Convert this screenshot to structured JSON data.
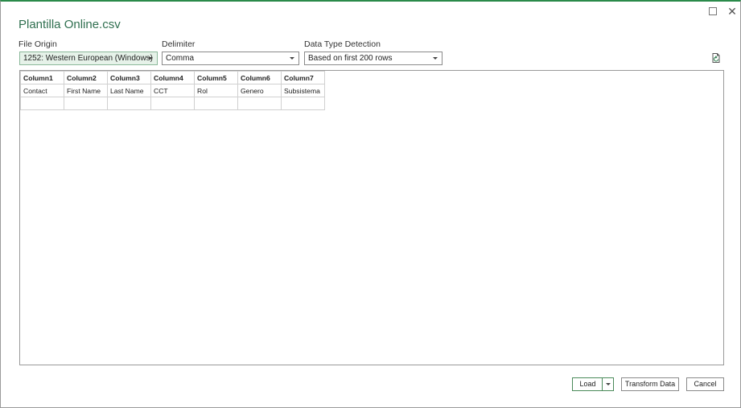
{
  "window": {
    "title": "Plantilla Online.csv",
    "restore_icon": "restore-icon",
    "close_icon": "close-icon",
    "close_glyph": "✕"
  },
  "options": {
    "file_origin": {
      "label": "File Origin",
      "value": "1252: Western European (Windows)"
    },
    "delimiter": {
      "label": "Delimiter",
      "value": "Comma"
    },
    "data_type_detection": {
      "label": "Data Type Detection",
      "value": "Based on first 200 rows"
    },
    "refresh_icon": "refresh-document-icon"
  },
  "preview": {
    "columns": [
      "Column1",
      "Column2",
      "Column3",
      "Column4",
      "Column5",
      "Column6",
      "Column7"
    ],
    "rows": [
      [
        "Contact",
        "First Name",
        "Last Name",
        "CCT",
        "Rol",
        "Genero",
        "Subsistema"
      ],
      [
        "",
        "",
        "",
        "",
        "",
        "",
        ""
      ]
    ]
  },
  "buttons": {
    "load": "Load",
    "transform": "Transform Data",
    "cancel": "Cancel"
  },
  "colors": {
    "accent": "#2f6f4f",
    "active_select_bg": "#e6f2e9"
  }
}
